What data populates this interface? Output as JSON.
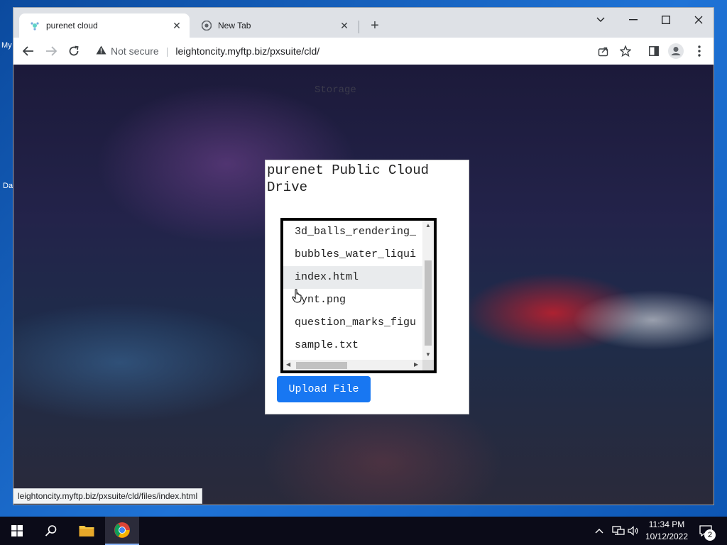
{
  "desktop": {
    "icon_text_1": "My",
    "icon_text_2": "Da"
  },
  "browser": {
    "tabs": [
      {
        "title": "purenet cloud",
        "favicon": "purenet-favicon",
        "active": true
      },
      {
        "title": "New Tab",
        "favicon": "chrome-icon",
        "active": false
      }
    ],
    "new_tab_symbol": "+",
    "security_label": "Not secure",
    "url": "leightoncity.myftp.biz/pxsuite/cld/",
    "status_url": "leightoncity.myftp.biz/pxsuite/cld/files/index.html"
  },
  "page": {
    "background_text": "Storage",
    "card_title": "purenet Public Cloud Drive",
    "files": [
      "3d_balls_rendering_",
      "bubbles_water_liqui",
      "index.html",
      "aynt.png",
      "question_marks_figu",
      "sample.txt"
    ],
    "hovered_file": "index.html",
    "upload_button": "Upload File"
  },
  "taskbar": {
    "time": "11:34 PM",
    "date": "10/12/2022",
    "notification_count": "2"
  },
  "colors": {
    "accent": "#1877f2",
    "taskbar": "#0b0b18",
    "tabbar": "#dee1e6"
  }
}
